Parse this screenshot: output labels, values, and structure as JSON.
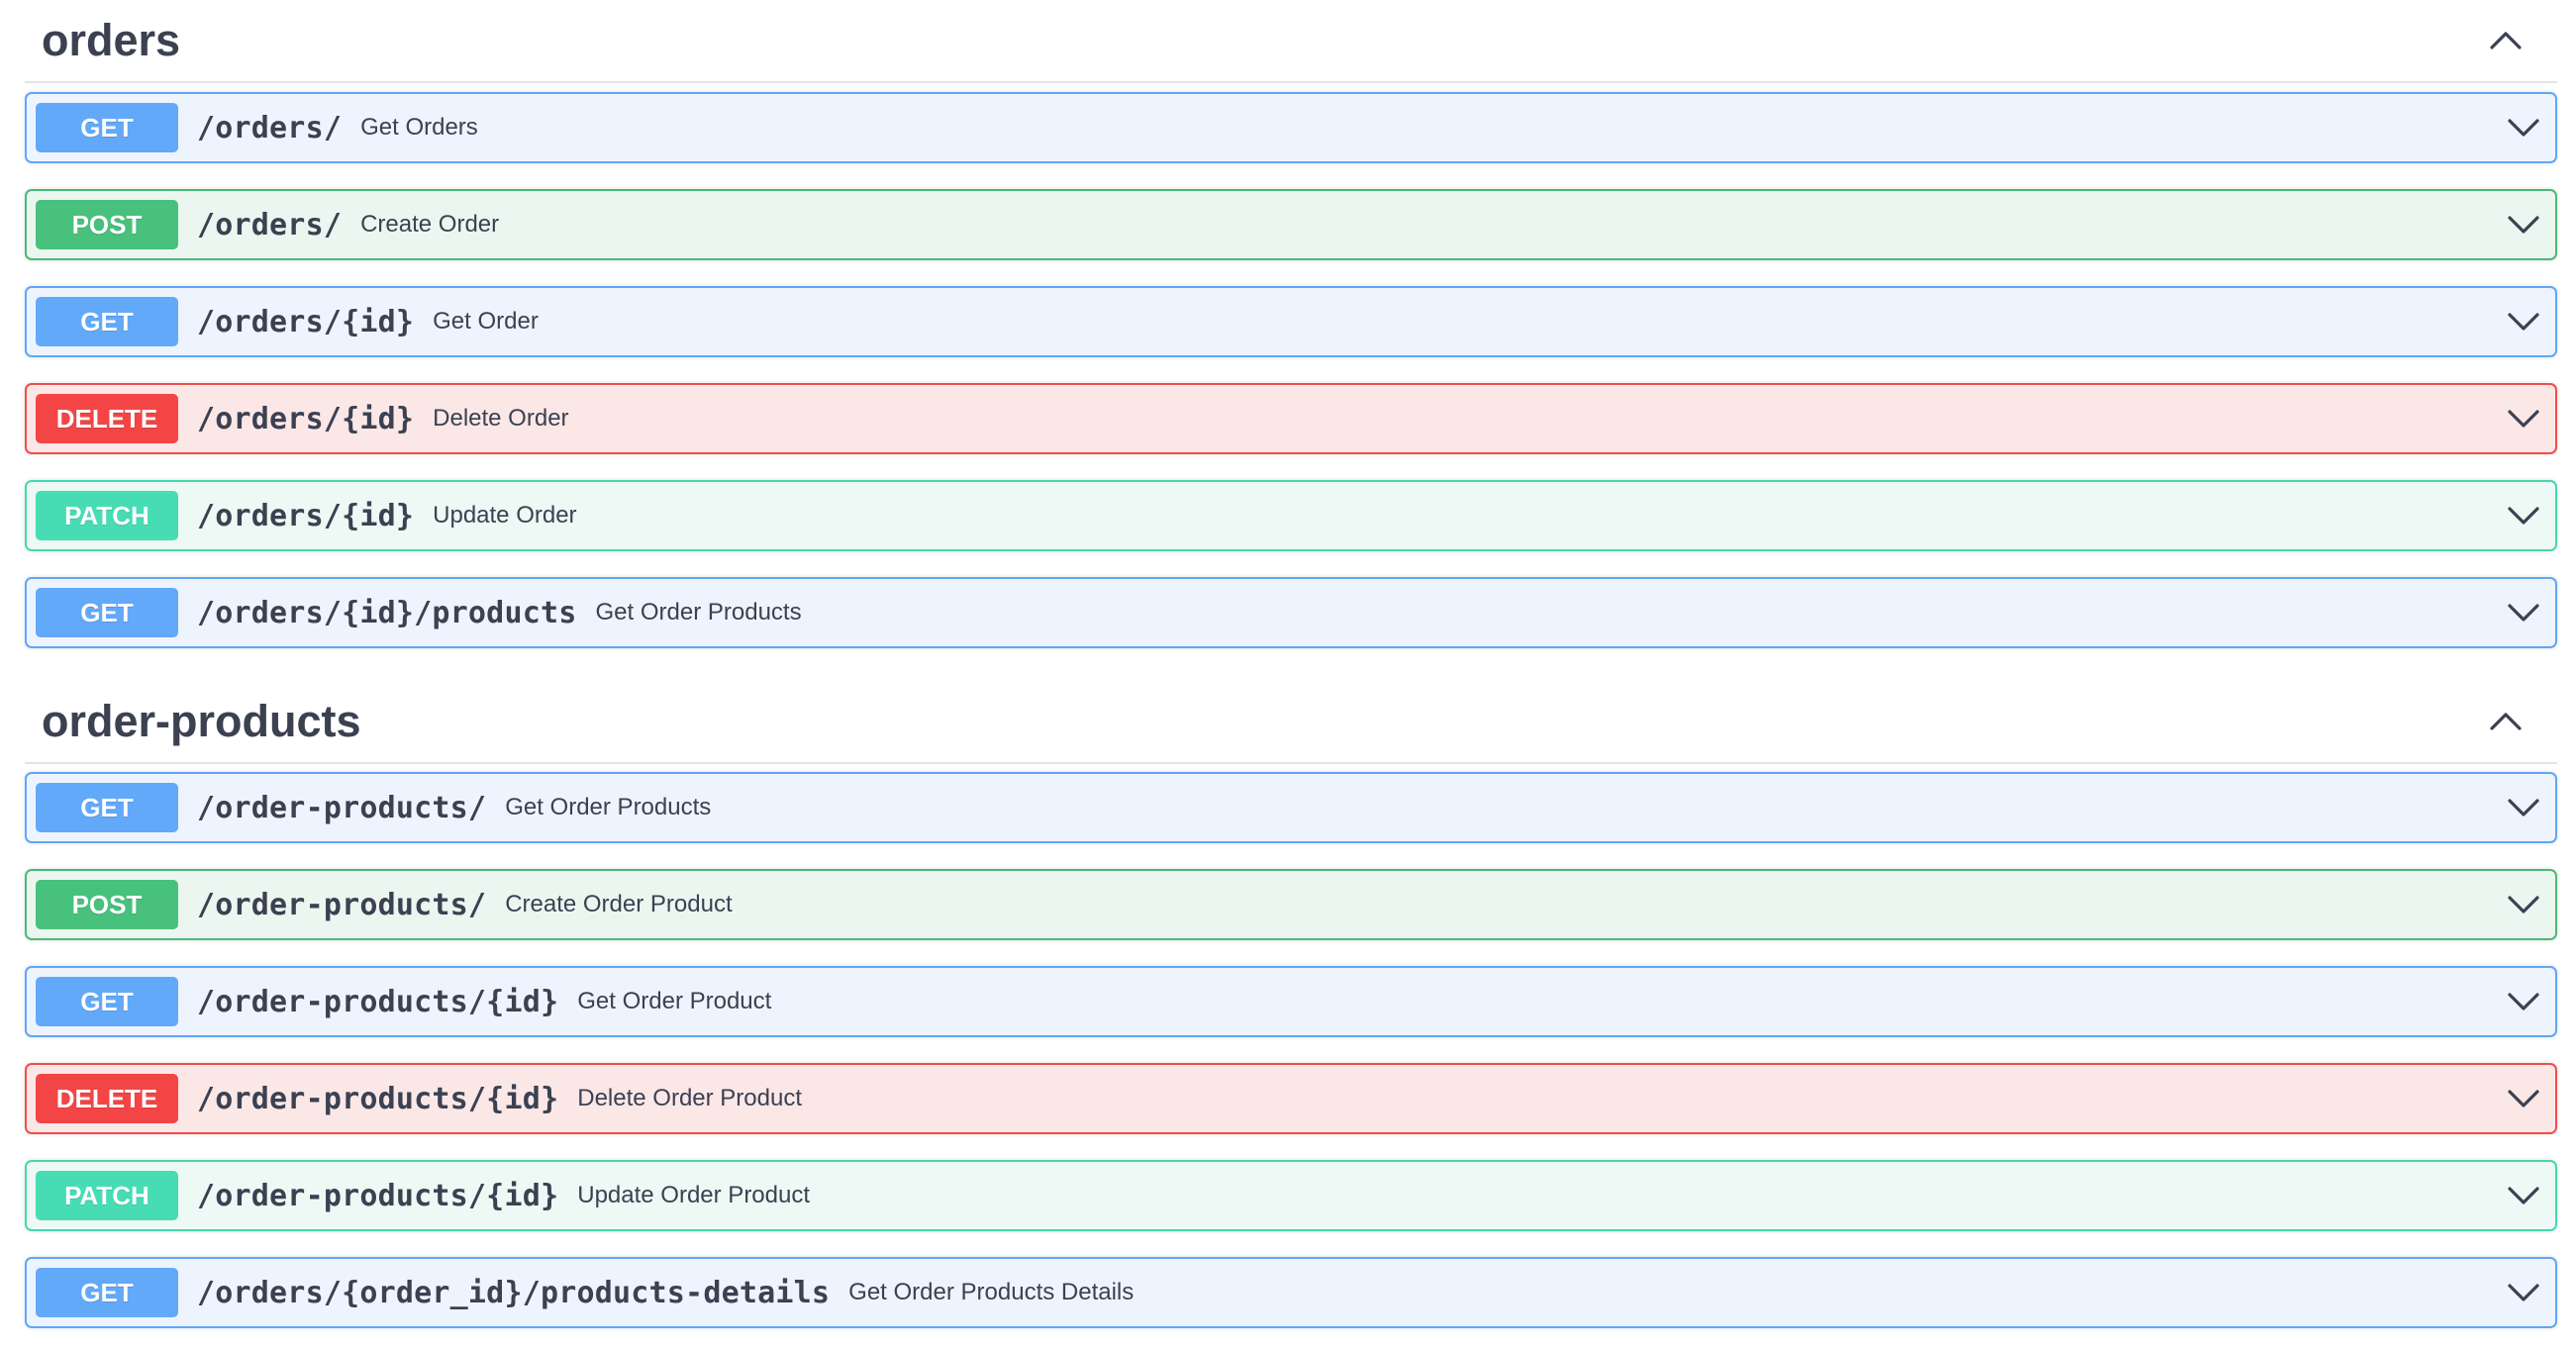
{
  "sections": [
    {
      "title": "orders",
      "operations": [
        {
          "method": "GET",
          "path": "/orders/",
          "summary": "Get Orders"
        },
        {
          "method": "POST",
          "path": "/orders/",
          "summary": "Create Order"
        },
        {
          "method": "GET",
          "path": "/orders/{id}",
          "summary": "Get Order"
        },
        {
          "method": "DELETE",
          "path": "/orders/{id}",
          "summary": "Delete Order"
        },
        {
          "method": "PATCH",
          "path": "/orders/{id}",
          "summary": "Update Order"
        },
        {
          "method": "GET",
          "path": "/orders/{id}/products",
          "summary": "Get Order Products"
        }
      ]
    },
    {
      "title": "order-products",
      "operations": [
        {
          "method": "GET",
          "path": "/order-products/",
          "summary": "Get Order Products"
        },
        {
          "method": "POST",
          "path": "/order-products/",
          "summary": "Create Order Product"
        },
        {
          "method": "GET",
          "path": "/order-products/{id}",
          "summary": "Get Order Product"
        },
        {
          "method": "DELETE",
          "path": "/order-products/{id}",
          "summary": "Delete Order Product"
        },
        {
          "method": "PATCH",
          "path": "/order-products/{id}",
          "summary": "Update Order Product"
        },
        {
          "method": "GET",
          "path": "/orders/{order_id}/products-details",
          "summary": "Get Order Products Details"
        }
      ]
    }
  ],
  "icons": {
    "section_toggle": "chevron-up-icon",
    "operation_toggle": "chevron-down-icon"
  },
  "colors": {
    "get": "#62a9fa",
    "post": "#47c17b",
    "delete": "#f34545",
    "patch": "#47dcb4",
    "text": "#3b4151"
  }
}
